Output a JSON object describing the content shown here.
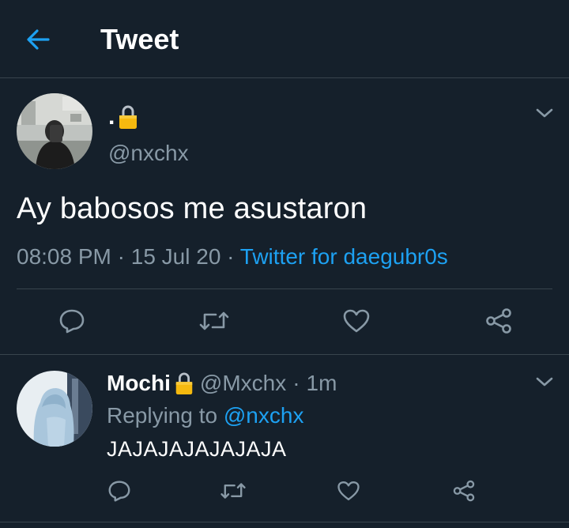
{
  "header": {
    "title": "Tweet",
    "back_icon": "arrow-left-icon"
  },
  "tweet": {
    "display_name": ".",
    "name_badge_icon": "lock-icon",
    "handle": "@nxchx",
    "text": "Ay babosos me asustaron",
    "time": "08:08 PM",
    "date": "15 Jul 20",
    "separator": "·",
    "source": "Twitter for daegubr0s",
    "actions": [
      "reply-icon",
      "retweet-icon",
      "like-icon",
      "share-icon"
    ]
  },
  "reply": {
    "display_name": "Mochi",
    "name_badge_icon": "lock-icon",
    "handle": "@Mxchx",
    "separator": "·",
    "time": "1m",
    "replying_prefix": "Replying to",
    "replying_to": "@nxchx",
    "text": "JAJAJAJAJAJAJA",
    "actions": [
      "reply-icon",
      "retweet-icon",
      "like-icon",
      "share-icon"
    ]
  },
  "colors": {
    "background": "#15202b",
    "accent": "#1da1f2",
    "secondary_text": "#8899a6",
    "divider": "#38444d",
    "lock": "#f5b90f"
  }
}
